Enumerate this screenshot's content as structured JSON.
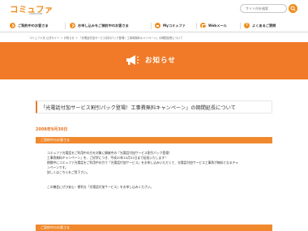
{
  "header": {
    "logo_text": "コミュファ",
    "logo_sub": "commufa",
    "search_placeholder": "サイト内を検索"
  },
  "nav": {
    "items": [
      {
        "label": "ご契約中のお客さま"
      },
      {
        "label": "お申し込みをご検討中のお客さま"
      },
      {
        "label": "Myコミュファ"
      },
      {
        "label": "Webメール"
      },
      {
        "label": "よくあるご質問"
      }
    ]
  },
  "breadcrumb": {
    "text": "コミュファ光 公式サイト ＞ お知らせ ＞ 「光電話付加サービス割引パック登場！工事費無料キャンペーン」の期間延長について"
  },
  "banner": {
    "title": "お知らせ"
  },
  "article": {
    "title": "「光電話付加サービス割引パック登場！工事費無料キャンペーン」の期間延長について",
    "date": "2008年9月30日",
    "section1_label": "ご契約中のお客さま",
    "lines": [
      "コミュファ光電話をご利用中の方を対象に開催中の「光電話付加サービス割引パック登場！",
      "工事費無料キャンペーン」を、ご好評につき、平成20年10月31日まで延長いたします！",
      "期間中にコミュファ光電話をご利用中の方で「光電話付加サービス」をお申し込みいただくと、光電話付加サービス工事費が無料となるキャ",
      "ンペーンです。",
      "詳しくはこちらをご覧下さい。",
      "",
      "この機会にぜひ安心・便利な「光電話付加サービス」をお申し込みください。"
    ],
    "section2_label": "ご契約中のお客さま"
  },
  "colors": {
    "accent": "#f07a28",
    "brand": "#f08c1e"
  },
  "icons": {
    "search": "search-icon",
    "megaphone": "megaphone-icon"
  }
}
